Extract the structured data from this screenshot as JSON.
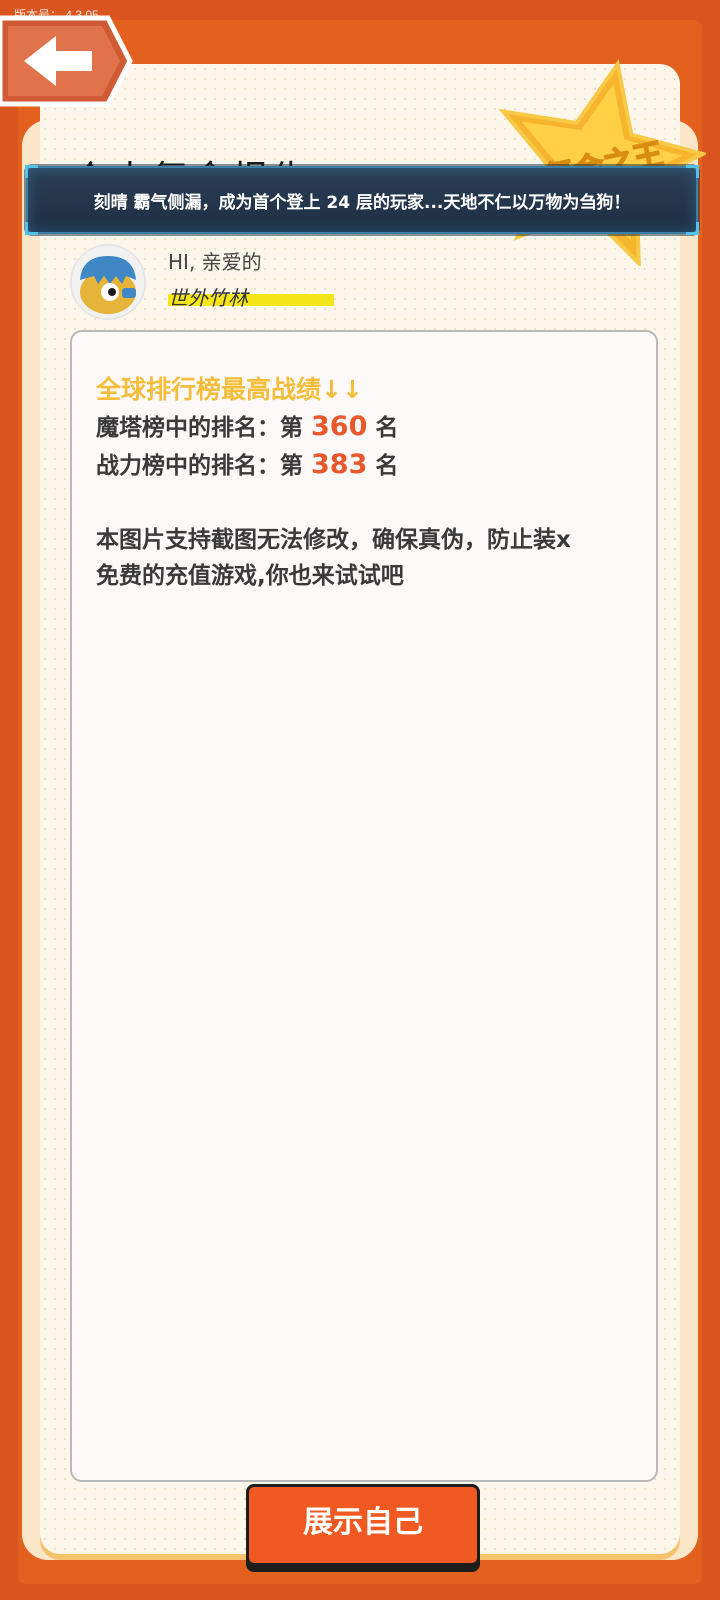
{
  "version_label": "版本号：  4.3.05",
  "badge_text": "氪金之王",
  "page_title": "个人氪金报告",
  "banner_message": "刻晴 霸气侧漏，成为首个登上 24 层的玩家...天地不仁以万物为刍狗！",
  "user": {
    "greeting": "HI, 亲爱的",
    "name": "世外竹林"
  },
  "ranking": {
    "heading": "全球排行榜最高战绩↓↓",
    "tower": {
      "prefix": "魔塔榜中的排名：第",
      "value": "360",
      "suffix": "名"
    },
    "power": {
      "prefix": "战力榜中的排名：第",
      "value": "383",
      "suffix": "名"
    }
  },
  "notice_lines": [
    "本图片支持截图无法修改，确保真伪，防止装x",
    "免费的充值游戏,你也来试试吧"
  ],
  "show_button_label": "展示自己",
  "icons": {
    "back": "arrow-left-icon",
    "avatar": "cartoon-character-avatar",
    "badge": "star-badge-icon"
  },
  "colors": {
    "frame": "#e2611f",
    "heading": "#f5bd3c",
    "rank_number": "#e9582a",
    "button": "#f05a22",
    "highlight": "#f5e61a"
  }
}
